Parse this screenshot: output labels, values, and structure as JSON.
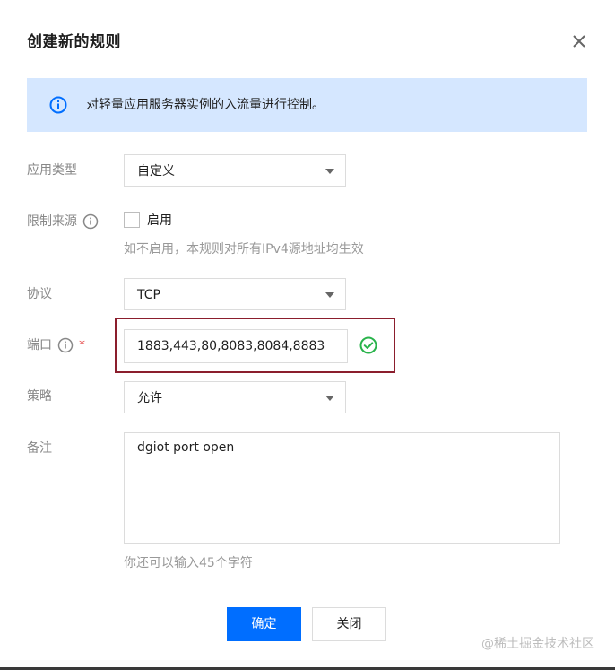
{
  "dialog": {
    "title": "创建新的规则",
    "close_icon": "close-icon"
  },
  "info": {
    "icon": "info-circle-icon",
    "text": "对轻量应用服务器实例的入流量进行控制。",
    "background_color": "#d5e7ff"
  },
  "form": {
    "app_type": {
      "label": "应用类型",
      "value": "自定义"
    },
    "source": {
      "label": "限制来源",
      "checkbox_label": "启用",
      "checked": false,
      "hint": "如不启用，本规则对所有IPv4源地址均生效"
    },
    "protocol": {
      "label": "协议",
      "value": "TCP"
    },
    "port": {
      "label": "端口",
      "required_mark": "*",
      "value": "1883,443,80,8083,8084,8883",
      "valid_icon": "check-circle-icon"
    },
    "policy": {
      "label": "策略",
      "value": "允许"
    },
    "remark": {
      "label": "备注",
      "value": "dgiot port open",
      "hint": "你还可以输入45个字符"
    }
  },
  "buttons": {
    "confirm": "确定",
    "close": "关闭"
  },
  "watermark": "@稀土掘金技术社区",
  "colors": {
    "primary": "#006eff",
    "success": "#29b34b",
    "required": "#e54545",
    "highlight_border": "#8b1e2d"
  }
}
